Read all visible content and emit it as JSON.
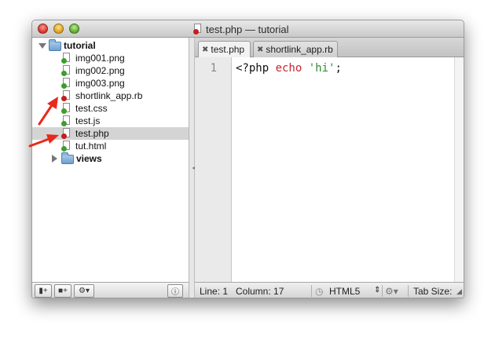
{
  "window": {
    "title": "test.php — tutorial"
  },
  "tree": {
    "root": "tutorial",
    "items": [
      {
        "label": "img001.png",
        "badge": "green"
      },
      {
        "label": "img002.png",
        "badge": "green"
      },
      {
        "label": "img003.png",
        "badge": "green"
      },
      {
        "label": "shortlink_app.rb",
        "badge": "red"
      },
      {
        "label": "test.css",
        "badge": "green"
      },
      {
        "label": "test.js",
        "badge": "green"
      },
      {
        "label": "test.php",
        "badge": "red",
        "selected": true
      },
      {
        "label": "tut.html",
        "badge": "green"
      }
    ],
    "subfolder": "views"
  },
  "tabs": [
    {
      "label": "test.php",
      "active": true
    },
    {
      "label": "shortlink_app.rb",
      "active": false
    }
  ],
  "editor": {
    "line_number": "1",
    "code": {
      "open": "<?php ",
      "keyword": "echo",
      "space": " ",
      "string": "'hi'",
      "end": ";"
    }
  },
  "status": {
    "line": "Line: 1",
    "column": "Column: 17",
    "language": "HTML5",
    "tab_size": "Tab Size:"
  },
  "colors": {
    "badge_green": "#3d9d2e",
    "badge_red": "#c41e1e",
    "keyword": "#c5262f",
    "string": "#2f8a2b",
    "arrow": "#e8291c"
  }
}
